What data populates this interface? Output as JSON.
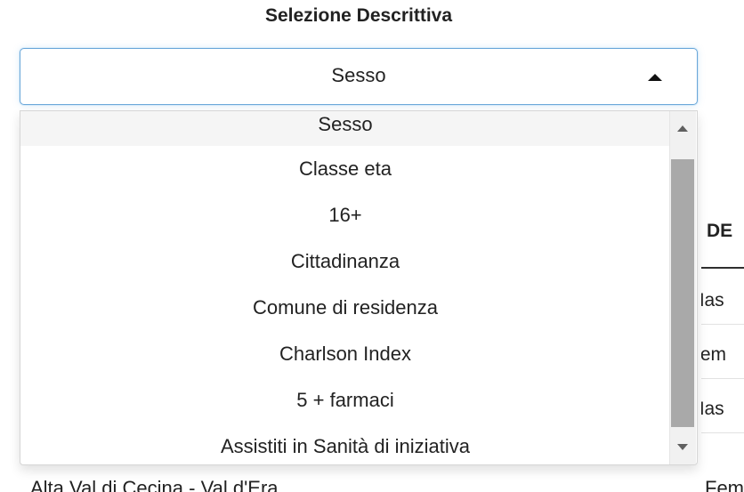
{
  "section": {
    "title": "Selezione Descrittiva"
  },
  "select": {
    "value": "Sesso",
    "open": true
  },
  "dropdown": {
    "options": [
      "Sesso",
      "Classe eta",
      "16+",
      "Cittadinanza",
      "Comune di residenza",
      "Charlson Index",
      "5 + farmaci",
      "Assistiti in Sanità di iniziativa"
    ],
    "selected_index": 0
  },
  "background_table": {
    "header_partial": "DE",
    "row_labels_partial": [
      "Mas",
      "Fem",
      "Mas"
    ],
    "bottom_left_partial": "Alta Val di Cecina - Val d'Era",
    "bottom_right_partial": "Fem"
  },
  "icons": {
    "select_arrow": "caret-up-icon",
    "scroll_up": "scroll-up-icon",
    "scroll_down": "scroll-down-icon"
  },
  "colors": {
    "select_border": "#6aa7d9",
    "selected_option_background": "#f5f5f5",
    "scroll_thumb": "#a9a9a9"
  }
}
